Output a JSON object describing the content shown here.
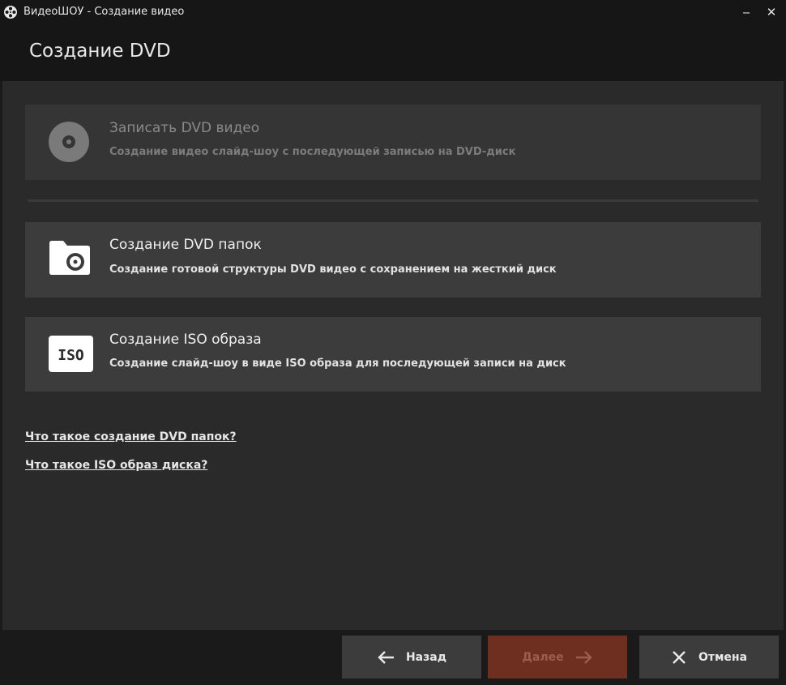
{
  "window": {
    "title": "ВидеоШОУ - Создание видео",
    "minimize_glyph": "‒",
    "close_glyph": "✕"
  },
  "header": {
    "title": "Создание DVD"
  },
  "options": [
    {
      "title": "Записать DVD видео",
      "description": "Создание видео слайд-шоу с последующей записью на DVD-диск",
      "icon": "disc-icon",
      "enabled": false
    },
    {
      "title": "Создание DVD папок",
      "description": "Создание готовой структуры DVD видео с сохранением на жесткий диск",
      "icon": "folder-disc-icon",
      "enabled": true
    },
    {
      "title": "Создание ISO образа",
      "description": "Создание слайд-шоу в виде ISO образа для последующей записи на диск",
      "icon": "iso-icon",
      "icon_text": "ISO",
      "enabled": true
    }
  ],
  "links": [
    {
      "label": "Что такое создание DVD папок?"
    },
    {
      "label": "Что такое ISO образ диска?"
    }
  ],
  "footer": {
    "back_label": "Назад",
    "next_label": "Далее",
    "cancel_label": "Отмена"
  },
  "colors": {
    "accent": "#6e2f21",
    "panel": "#3c3c3c",
    "background": "#2a2a2a"
  }
}
